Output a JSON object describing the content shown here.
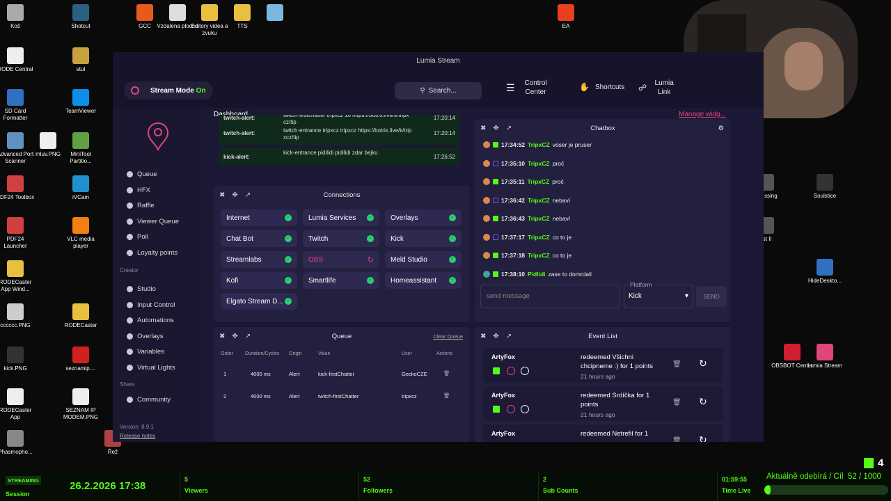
{
  "desktop_icons": [
    {
      "label": "Koš",
      "color": "#aaa"
    },
    {
      "label": "Shotcut",
      "color": "#2a6080"
    },
    {
      "label": "GCC",
      "color": "#e85a1a"
    },
    {
      "label": "Vzdalena plocha",
      "color": "#ddd"
    },
    {
      "label": "Editory videa a zvuku",
      "color": "#e8c040"
    },
    {
      "label": "TTS",
      "color": "#e8c040"
    },
    {
      "label": "",
      "color": "#7ab8e0"
    },
    {
      "label": "EA",
      "color": "#e84020"
    },
    {
      "label": "RODE Central",
      "color": "#eee"
    },
    {
      "label": "stul",
      "color": "#c8a040"
    },
    {
      "label": "SD Card Formatter",
      "color": "#3070c0"
    },
    {
      "label": "TeamViewer",
      "color": "#0e8ee9"
    },
    {
      "label": "Advanced Port Scanner",
      "color": "#6090c0"
    },
    {
      "label": "mluv.PNG",
      "color": "#eee"
    },
    {
      "label": "MiniTool Partitio...",
      "color": "#60a040"
    },
    {
      "label": "PDF24 Toolbox",
      "color": "#d04040"
    },
    {
      "label": "iVCam",
      "color": "#2090d0"
    },
    {
      "label": "PDF24 Launcher",
      "color": "#d04040"
    },
    {
      "label": "VLC media player",
      "color": "#f08010"
    },
    {
      "label": "RODECaster App Wind...",
      "color": "#e8c040"
    },
    {
      "label": "cccccc.PNG",
      "color": "#ccc"
    },
    {
      "label": "RODECaster",
      "color": "#e8c040"
    },
    {
      "label": "kick.PNG",
      "color": "#333"
    },
    {
      "label": "seznamip....",
      "color": "#d02020"
    },
    {
      "label": "RODECaster App",
      "color": "#eee"
    },
    {
      "label": "SEZNAM IP MODEM.PNG",
      "color": "#eee"
    },
    {
      "label": "Phasmopho...",
      "color": "#888"
    },
    {
      "label": "Řež",
      "color": "#b04040"
    },
    {
      "label": "Soulstice",
      "color": "#333"
    },
    {
      "label": "HideDeskto...",
      "color": "#3070c0"
    },
    {
      "label": "OBSBOT Center",
      "color": "#d02030"
    },
    {
      "label": "Lumia Stream",
      "color": "#e0457b"
    },
    {
      "label": "tals ssing",
      "color": "#555"
    },
    {
      "label": "est II",
      "color": "#555"
    }
  ],
  "app": {
    "window_title": "Lumia Stream",
    "stream_mode_label": "Stream Mode",
    "stream_mode_state": "On",
    "search_label": "Search...",
    "control_center": "Control Center",
    "shortcuts": "Shortcuts",
    "lumia_link": "Lumia Link",
    "dashboard_title": "Dashboard",
    "manage_widgets": "Manage widg..."
  },
  "sidebar": {
    "items": [
      "Queue",
      "HFX",
      "Raffle",
      "Viewer Queue",
      "Poll",
      "Loyalty points"
    ],
    "creator_label": "Creator",
    "creator_items": [
      "Studio",
      "Input Control",
      "Automations",
      "Overlays",
      "Variables",
      "Virtual Lights"
    ],
    "share_label": "Share",
    "share_items": [
      "Community"
    ],
    "version": "Version: 8.9.1",
    "release_notes": "Release notes"
  },
  "alerts": [
    {
      "type": "twitch-alert:",
      "text": "twitch-firstchatter tripxcz 10 https://botrix.live/s/tripx cz/tip",
      "time": "17:20:14"
    },
    {
      "type": "twitch-alert:",
      "text": "twitch-entrance tripxcz tripxcz https://botrix.live/k/trip xcz/tip",
      "time": "17:20:14"
    },
    {
      "type": "kick-alert:",
      "text": "kick-entrance pidilidi pidilidi zdar bejku",
      "time": "17:26:52"
    }
  ],
  "connections": {
    "title": "Connections",
    "items": [
      {
        "name": "Internet",
        "status": "ok"
      },
      {
        "name": "Lumia Services",
        "status": "ok"
      },
      {
        "name": "Overlays",
        "status": "ok"
      },
      {
        "name": "Chat Bot",
        "status": "ok"
      },
      {
        "name": "Twitch",
        "status": "ok"
      },
      {
        "name": "Kick",
        "status": "ok"
      },
      {
        "name": "Streamlabs",
        "status": "ok"
      },
      {
        "name": "OBS",
        "status": "retry"
      },
      {
        "name": "Meld Studio",
        "status": "ok"
      },
      {
        "name": "Kofi",
        "status": "ok"
      },
      {
        "name": "Smartlife",
        "status": "ok"
      },
      {
        "name": "Homeassistant",
        "status": "ok"
      },
      {
        "name": "Elgato Stream D...",
        "status": "ok"
      }
    ]
  },
  "chatbox": {
    "title": "Chatbox",
    "messages": [
      {
        "platform": "kick",
        "time": "17:34:52",
        "user": "TripxCZ",
        "text": "voser je pruser"
      },
      {
        "platform": "twitch",
        "time": "17:35:10",
        "user": "TripxCZ",
        "text": "proč"
      },
      {
        "platform": "kick",
        "time": "17:35:11",
        "user": "TripxCZ",
        "text": "proč"
      },
      {
        "platform": "twitch",
        "time": "17:36:42",
        "user": "TripxCZ",
        "text": "nebaví"
      },
      {
        "platform": "kick",
        "time": "17:36:43",
        "user": "TripxCZ",
        "text": "nebaví"
      },
      {
        "platform": "twitch",
        "time": "17:37:17",
        "user": "TripxCZ",
        "text": "co to je"
      },
      {
        "platform": "kick",
        "time": "17:37:18",
        "user": "TripxCZ",
        "text": "co to je"
      },
      {
        "platform": "kick",
        "time": "17:38:10",
        "user": "Pidlidi",
        "text": "zase to domrdali"
      }
    ],
    "input_placeholder": "send message",
    "platform_label": "Platform",
    "platform_value": "Kick",
    "send_label": "SEND"
  },
  "queue": {
    "title": "Queue",
    "clear_label": "Clear Queue",
    "columns": [
      "Order",
      "Duration/Cycles",
      "Origin",
      "Value",
      "User",
      "Actions"
    ],
    "rows": [
      [
        "1",
        "4000 ms",
        "Alert",
        "kick-firstChatter",
        "GeckoCZE"
      ],
      [
        "2",
        "4000 ms",
        "Alert",
        "twitch-firstChatter",
        "tripxcz"
      ]
    ]
  },
  "events": {
    "title": "Event List",
    "items": [
      {
        "user": "ArtyFox",
        "text": "redeemed Všichni chcipneme :) for 1 points",
        "ago": "21 hours ago"
      },
      {
        "user": "ArtyFox",
        "text": "redeemed Srdíčka for 1 points",
        "ago": "21 hours ago"
      },
      {
        "user": "ArtyFox",
        "text": "redeemed Netrefil for 1",
        "ago": ""
      }
    ]
  },
  "footer": {
    "streaming_badge": "STREAMING",
    "session_label": "Session",
    "datetime": "26.2.2026 17:38",
    "viewers_count": "5",
    "viewers_label": "Viewers",
    "followers_count": "52",
    "followers_label": "Followers",
    "subs_count": "2",
    "subs_label": "Sub Counts",
    "time_live_value": "01:59:55",
    "time_live_label": "Time Live",
    "goal_text": "Aktuálně odebírá / Cíl",
    "goal_value": "52 / 1000",
    "goal_progress": 0.052,
    "kick_count": "4"
  },
  "colors": {
    "accent": "#e0457b",
    "kick": "#53fc18",
    "twitch": "#9146ff",
    "panel": "#231f3e"
  }
}
